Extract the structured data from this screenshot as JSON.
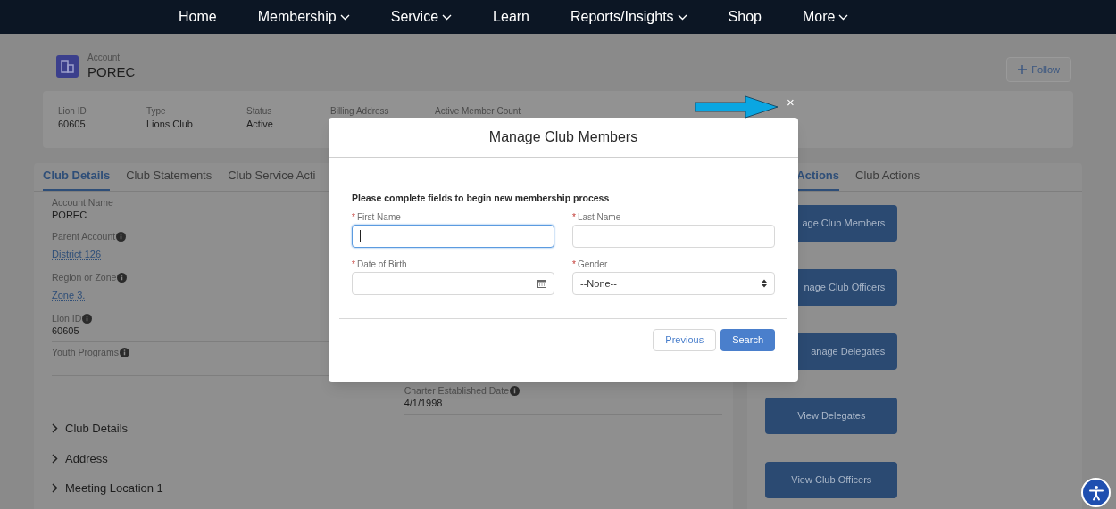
{
  "nav": [
    {
      "label": "Home",
      "dropdown": false
    },
    {
      "label": "Membership",
      "dropdown": true
    },
    {
      "label": "Service",
      "dropdown": true
    },
    {
      "label": "Learn",
      "dropdown": false
    },
    {
      "label": "Reports/Insights",
      "dropdown": true
    },
    {
      "label": "Shop",
      "dropdown": false
    },
    {
      "label": "More",
      "dropdown": true
    }
  ],
  "record": {
    "object_label": "Account",
    "name": "POREC",
    "follow_button": "Follow"
  },
  "highlights": [
    {
      "label": "Lion ID",
      "value": "60605"
    },
    {
      "label": "Type",
      "value": "Lions Club"
    },
    {
      "label": "Status",
      "value": "Active"
    },
    {
      "label": "Billing Address"
    },
    {
      "label": "Active Member Count"
    }
  ],
  "left_tabs": [
    {
      "label": "Club Details",
      "selected": true
    },
    {
      "label": "Club Statements",
      "selected": false
    },
    {
      "label": "Club Service Acti",
      "selected": false
    }
  ],
  "fields_left": [
    {
      "label": "Account Name",
      "value": "POREC",
      "info": false,
      "link": false
    },
    {
      "label": "Parent Account",
      "value": "District 126",
      "info": true,
      "link": true
    },
    {
      "label": "Region or Zone",
      "value": "Zone 3.",
      "info": true,
      "link": true
    },
    {
      "label": "Lion ID",
      "value": "60605",
      "info": true,
      "link": false
    },
    {
      "label": "Youth Programs",
      "info": true
    }
  ],
  "fields_right": [
    {
      "label": "Charter Established Date",
      "value": "4/1/1998",
      "info": true,
      "link": false
    }
  ],
  "sections": [
    {
      "label": "Club Details",
      "expanded": false
    },
    {
      "label": "Address",
      "expanded": false
    },
    {
      "label": "Meeting Location 1",
      "expanded": false
    }
  ],
  "right_tabs": [
    {
      "label": "Actions",
      "selected": true
    },
    {
      "label": "Club Actions",
      "selected": false
    }
  ],
  "action_buttons": [
    {
      "label": "age Club Members",
      "covered": true
    },
    {
      "label": "nage Club Officers",
      "covered": true
    },
    {
      "label": "anage Delegates",
      "covered": true
    },
    {
      "label": "View Delegates",
      "covered": false
    },
    {
      "label": "View Club Officers",
      "covered": false
    }
  ],
  "modal": {
    "title": "Manage Club Members",
    "close": "×",
    "instructions": "Please complete fields to begin new membership process",
    "fields": [
      {
        "label": "First Name",
        "required_mark": "*",
        "kind": "text",
        "focused": true
      },
      {
        "label": "Last Name",
        "required_mark": "*",
        "kind": "text",
        "focused": false
      },
      {
        "label": "Date of Birth",
        "required_mark": "*",
        "kind": "date",
        "focused": false
      },
      {
        "label": "Gender",
        "required_mark": "*",
        "kind": "select",
        "value": "--None--",
        "focused": false
      }
    ],
    "buttons": [
      {
        "label": "Previous",
        "kind": "secondary"
      },
      {
        "label": "Search",
        "kind": "primary"
      }
    ]
  }
}
